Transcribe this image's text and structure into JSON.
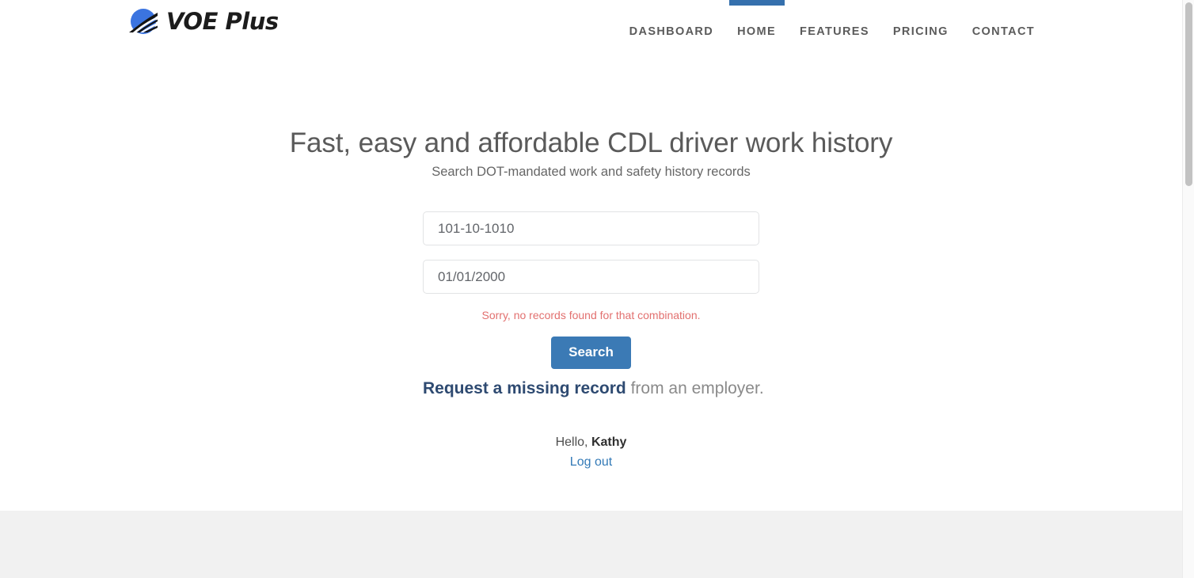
{
  "header": {
    "brand": {
      "logo_icon": "voe-plus-road-circle-logo",
      "text": "VOE Plus",
      "logo_colors": {
        "circle": "#3b74e0",
        "road_dark": "#141414",
        "road_light": "#ffffff"
      }
    },
    "nav": {
      "active_indicator_color": "#3570ad",
      "items": [
        {
          "label": "DASHBOARD",
          "active": false
        },
        {
          "label": "HOME",
          "active": true
        },
        {
          "label": "FEATURES",
          "active": false
        },
        {
          "label": "PRICING",
          "active": false
        },
        {
          "label": "CONTACT",
          "active": false
        }
      ]
    }
  },
  "hero": {
    "title": "Fast, easy and affordable CDL driver work history",
    "subtitle": "Search DOT-mandated work and safety history records"
  },
  "search": {
    "ssn_field": {
      "value": "101-10-1010",
      "placeholder": "101-10-1010"
    },
    "dob_field": {
      "value": "01/01/2000",
      "placeholder": "01/01/2000"
    },
    "error_message": "Sorry, no records found for that combination.",
    "error_color": "#e2706f",
    "submit_label": "Search",
    "submit_color": "#3b7ab5",
    "missing_record": {
      "link_text": "Request a missing record",
      "trailing_text": " from an employer.",
      "link_color": "#2e4a71"
    }
  },
  "account": {
    "greeting_prefix": "Hello, ",
    "user_name": "Kathy",
    "logout_label": "Log out",
    "logout_color": "#337ab7"
  },
  "footer": {
    "band_color": "#f1f1f1"
  },
  "scrollbar": {
    "track_color": "#fafafa",
    "thumb_color": "#c2c2c2"
  }
}
